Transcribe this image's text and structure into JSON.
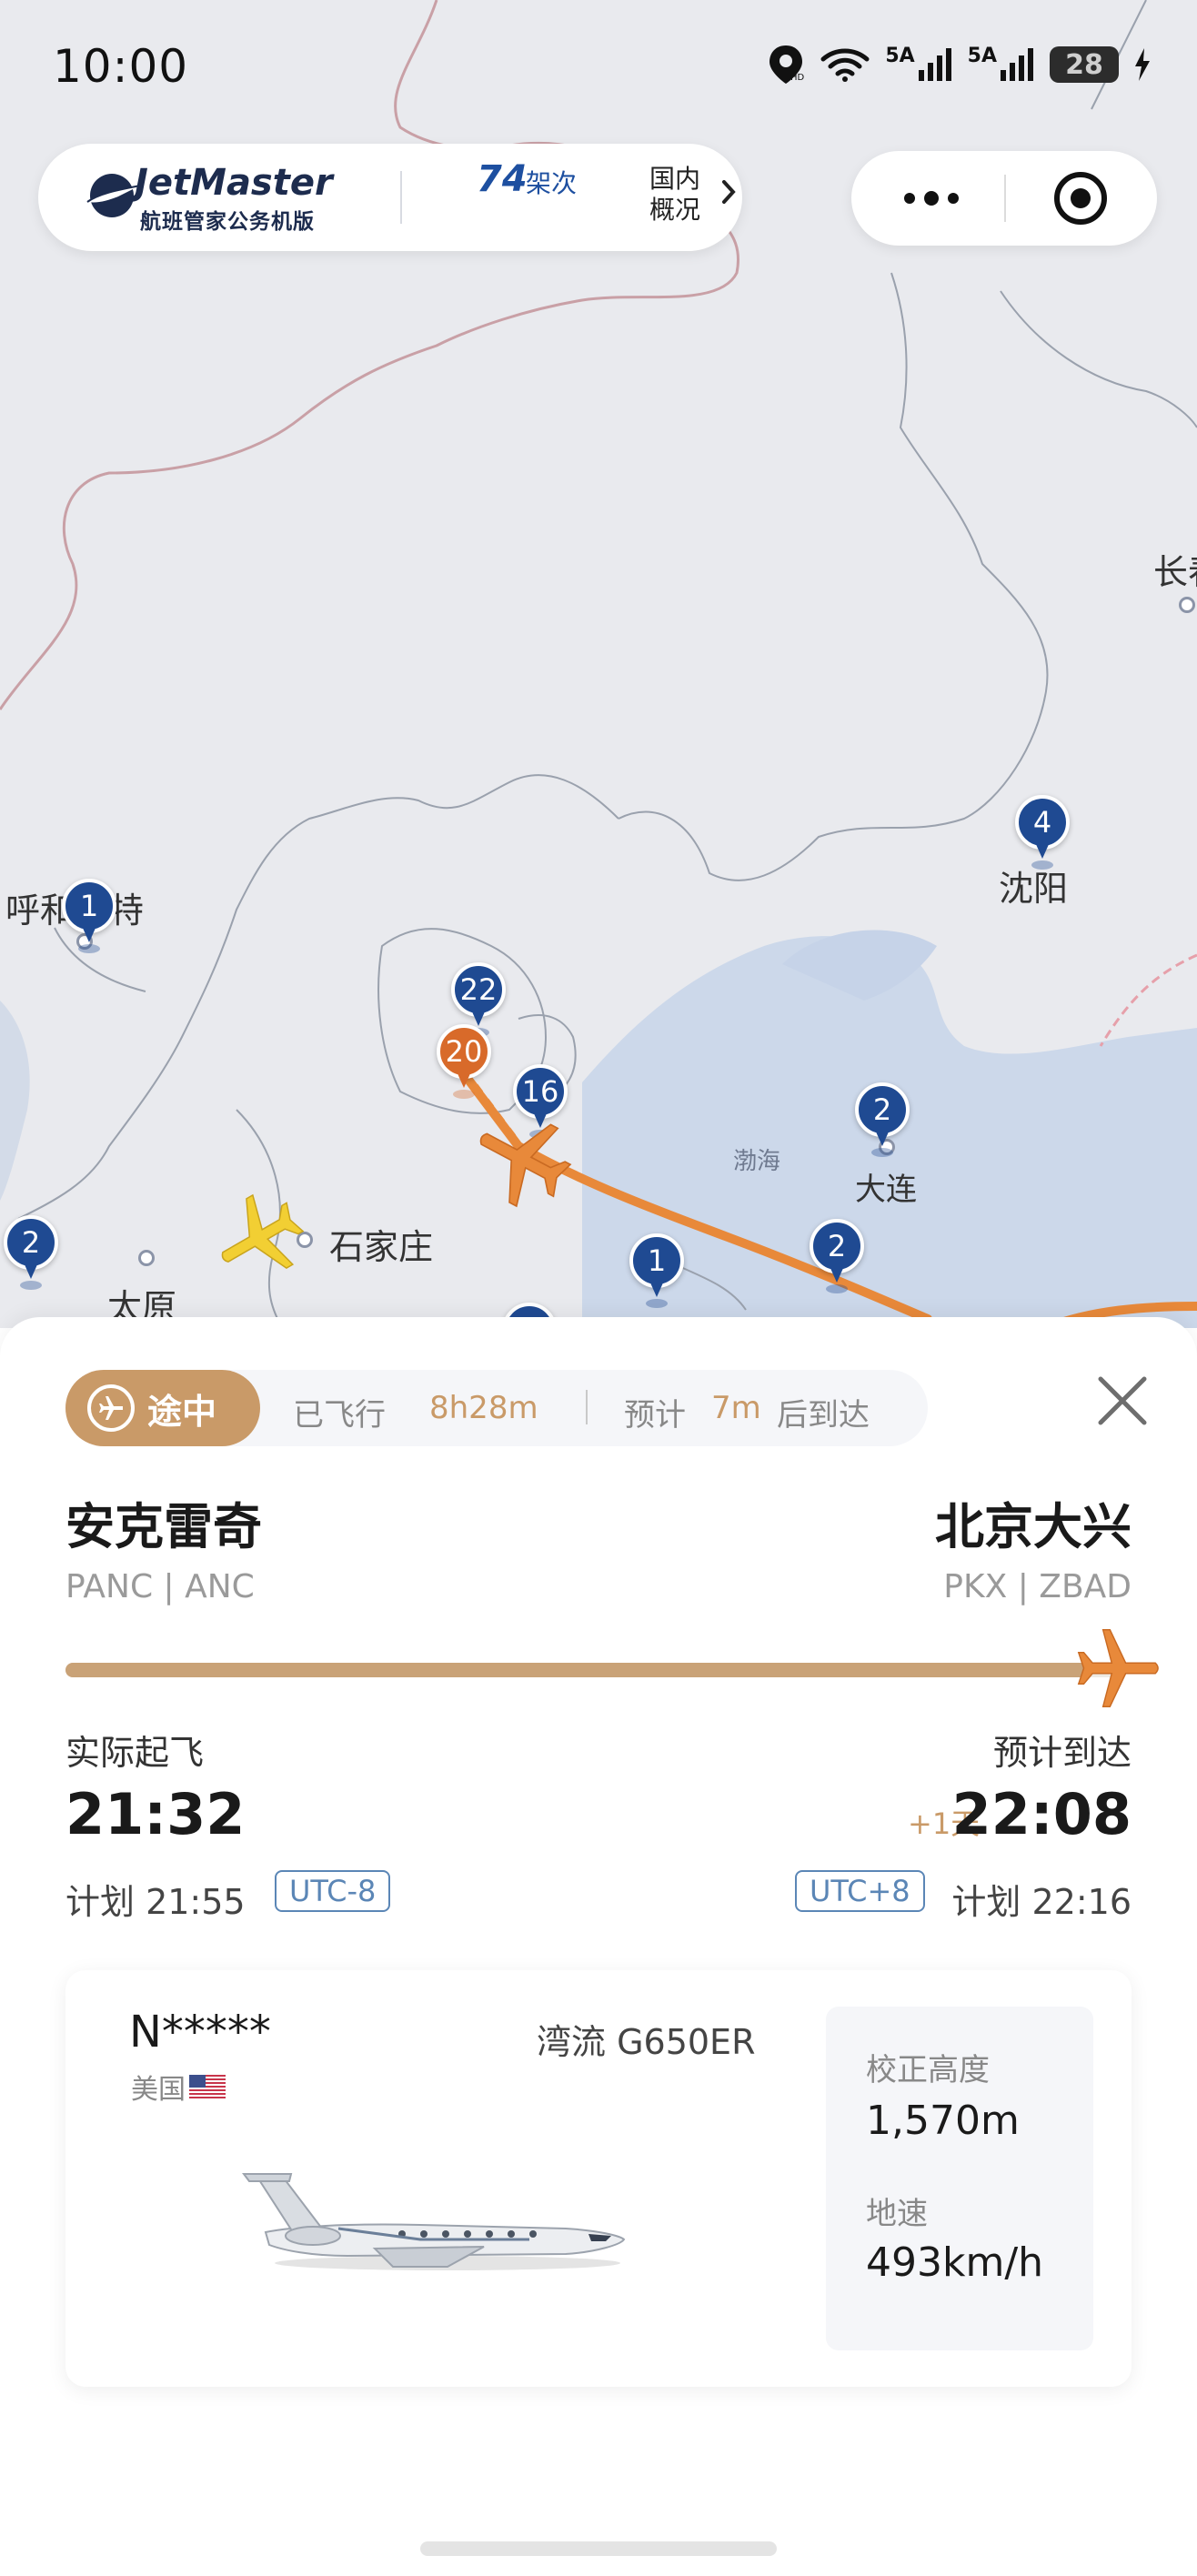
{
  "status_bar": {
    "time": "10:00",
    "network_1": "5A",
    "network_2": "5A",
    "battery": "28",
    "icons": [
      "location-hd-icon",
      "wifi-icon",
      "signal-icon",
      "signal-icon",
      "battery-icon",
      "charging-icon"
    ]
  },
  "header": {
    "brand_name": "JetMaster",
    "brand_subtitle": "航班管家公务机版",
    "flight_count": "74",
    "flight_count_unit": "架次",
    "domestic_label": "国内概况"
  },
  "map": {
    "cities": [
      {
        "name": "呼和浩特"
      },
      {
        "name": "沈阳"
      },
      {
        "name": "石家庄"
      },
      {
        "name": "太原"
      },
      {
        "name": "大连"
      },
      {
        "name": "渤海"
      },
      {
        "name": "长春"
      }
    ],
    "pins": [
      {
        "count": "1"
      },
      {
        "count": "4"
      },
      {
        "count": "22"
      },
      {
        "count": "20"
      },
      {
        "count": "16"
      },
      {
        "count": "2"
      },
      {
        "count": "2"
      },
      {
        "count": "1"
      },
      {
        "count": "2"
      }
    ]
  },
  "flight": {
    "status": "途中",
    "flown_label": "已飞行",
    "flown_value": "8h28m",
    "eta_label": "预计",
    "eta_value": "7m",
    "eta_suffix": "后到达",
    "progress": 0.97,
    "origin": {
      "city": "安克雷奇",
      "codes": "PANC | ANC"
    },
    "destination": {
      "city": "北京大兴",
      "codes": "PKX | ZBAD"
    },
    "departure": {
      "label": "实际起飞",
      "time": "21:32",
      "scheduled": "计划 21:55",
      "timezone": "UTC-8"
    },
    "arrival": {
      "label": "预计到达",
      "time": "22:08",
      "day_offset": "+1天",
      "scheduled": "计划 22:16",
      "timezone": "UTC+8"
    }
  },
  "aircraft": {
    "registration": "N*****",
    "country": "美国",
    "model": "湾流 G650ER",
    "altitude_label": "校正高度",
    "altitude_value": "1,570m",
    "speed_label": "地速",
    "speed_value": "493km/h"
  },
  "colors": {
    "accent_gold": "#c99a68",
    "route_orange": "#e8893a",
    "pin_blue": "#1f4a92",
    "pin_orange": "#d86a2a"
  }
}
